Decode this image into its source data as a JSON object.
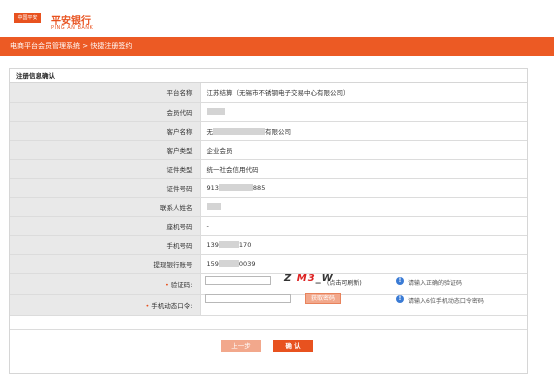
{
  "header": {
    "logo_badge": "中国平安",
    "bank_name": "平安银行",
    "bank_name_en": "PING AN BANK"
  },
  "nav": {
    "breadcrumb": "电商平台会员管理系统 > 快捷注册签约"
  },
  "panel": {
    "title": "注册信息确认"
  },
  "rows": [
    {
      "label": "平台名称",
      "value": "江苏结算（无锡市不锈钢电子交易中心有限公司）"
    },
    {
      "label": "会员代码",
      "value": ""
    },
    {
      "label": "客户名称",
      "value_prefix": "无",
      "value_suffix": "有限公司"
    },
    {
      "label": "客户类型",
      "value": "企业会员"
    },
    {
      "label": "证件类型",
      "value": "统一社会信用代码"
    },
    {
      "label": "证件号码",
      "value_prefix": "913",
      "value_suffix": "885"
    },
    {
      "label": "联系人姓名",
      "value": ""
    },
    {
      "label": "座机号码",
      "value": "-"
    },
    {
      "label": "手机号码",
      "value_prefix": "139",
      "value_suffix": "170"
    },
    {
      "label": "提现银行账号",
      "value_prefix": "159",
      "value_suffix": "0039"
    }
  ],
  "captcha": {
    "label": "验证码:",
    "value": "",
    "image_text_a": "Z",
    "image_text_b": "M3",
    "image_text_c": "W",
    "refresh_hint": "(点击可刷新)",
    "hint": "请输入正确的验证码"
  },
  "sms": {
    "label": "手机动态口令:",
    "value": "",
    "button": "获取密码",
    "hint": "请输入6位手机动态口令密码"
  },
  "buttons": {
    "prev": "上一步",
    "confirm": "确 认"
  },
  "colors": {
    "brand": "#e8521f",
    "nav": "#ec5a24",
    "label_bg": "#e9e9e9"
  }
}
